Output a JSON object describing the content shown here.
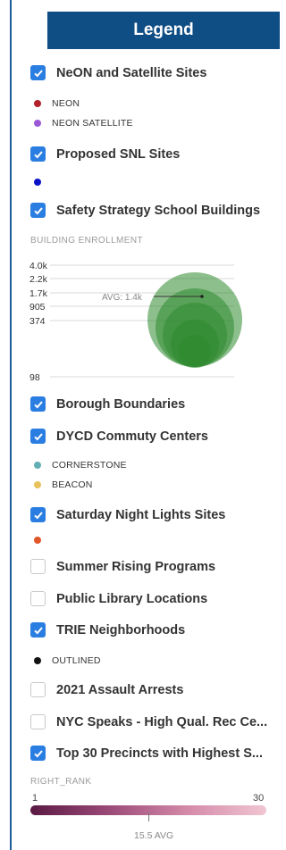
{
  "header": {
    "title": "Legend"
  },
  "layers": [
    {
      "label": "NeON and Satellite Sites",
      "checked": true
    },
    {
      "label": "Proposed SNL Sites",
      "checked": true
    },
    {
      "label": "Safety Strategy School Buildings",
      "checked": true
    },
    {
      "label": "Borough Boundaries",
      "checked": true
    },
    {
      "label": "DYCD Commuty Centers",
      "checked": true
    },
    {
      "label": "Saturday Night Lights Sites",
      "checked": true
    },
    {
      "label": "Summer Rising Programs",
      "checked": false
    },
    {
      "label": "Public Library Locations",
      "checked": false
    },
    {
      "label": "TRIE Neighborhoods",
      "checked": true
    },
    {
      "label": "2021 Assault Arrests",
      "checked": false
    },
    {
      "label": "NYC Speaks - High Qual. Rec Ce...",
      "checked": false
    },
    {
      "label": "Top 30 Precincts with Highest S...",
      "checked": true
    }
  ],
  "neon_items": [
    {
      "label": "NEON",
      "color": "#b3202a"
    },
    {
      "label": "NEON SATELLITE",
      "color": "#9b59d6"
    }
  ],
  "snl_dot": {
    "color": "#0b12c8"
  },
  "enrollment": {
    "title": "BUILDING ENROLLMENT",
    "ticks": [
      "4.0k",
      "2.2k",
      "1.7k",
      "905",
      "374",
      "98"
    ],
    "avg_label": "AVG: 1.4k",
    "bubble_color": "#2f8b2f"
  },
  "dycd_items": [
    {
      "label": "CORNERSTONE",
      "color": "#63aeb5"
    },
    {
      "label": "BEACON",
      "color": "#e7c25a"
    }
  ],
  "snl_sites_dot": {
    "color": "#e0572a"
  },
  "trie_items": [
    {
      "label": "OUTLINED",
      "color": "#111111"
    }
  ],
  "rank": {
    "title": "RIGHT_RANK",
    "min_label": "1",
    "max_label": "30",
    "avg_label": "15.5 AVG"
  }
}
